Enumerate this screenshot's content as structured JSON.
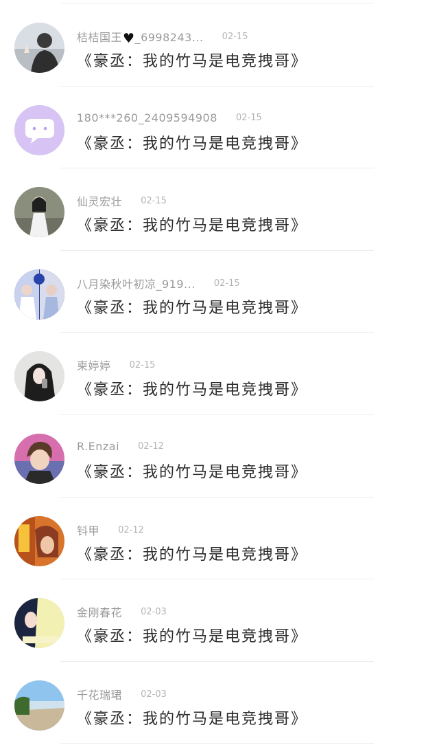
{
  "comments": [
    {
      "username": "桔桔国王",
      "username_suffix": "_6998243...",
      "has_heart": true,
      "date": "02-15",
      "text": "《豪丞：我的竹马是电竞拽哥》",
      "avatar": "avatar-woman-grey"
    },
    {
      "username": "180***260_2409594908",
      "username_suffix": "",
      "has_heart": false,
      "date": "02-15",
      "text": "《豪丞：我的竹马是电竞拽哥》",
      "avatar": "avatar-default-purple-chat-icon"
    },
    {
      "username": "仙灵宏壮",
      "username_suffix": "",
      "has_heart": false,
      "date": "02-15",
      "text": "《豪丞：我的竹马是电竞拽哥》",
      "avatar": "avatar-girl-outdoor"
    },
    {
      "username": "八月染秋叶初凉_919...",
      "username_suffix": "",
      "has_heart": false,
      "date": "02-15",
      "text": "《豪丞：我的竹马是电竞拽哥》",
      "avatar": "avatar-couple-blue"
    },
    {
      "username": "柬婷婷",
      "username_suffix": "",
      "has_heart": false,
      "date": "02-15",
      "text": "《豪丞：我的竹马是电竞拽哥》",
      "avatar": "avatar-girl-long-hair"
    },
    {
      "username": "R.Enzai",
      "username_suffix": "",
      "has_heart": false,
      "date": "02-12",
      "text": "《豪丞：我的竹马是电竞拽哥》",
      "avatar": "avatar-boy-pink"
    },
    {
      "username": "钭甲",
      "username_suffix": "",
      "has_heart": false,
      "date": "02-12",
      "text": "《豪丞：我的竹马是电竞拽哥》",
      "avatar": "avatar-anime-orange"
    },
    {
      "username": "金刚春花",
      "username_suffix": "",
      "has_heart": false,
      "date": "02-03",
      "text": "《豪丞：我的竹马是电竞拽哥》",
      "avatar": "avatar-anime-yellow"
    },
    {
      "username": "千花瑞珺",
      "username_suffix": "",
      "has_heart": false,
      "date": "02-03",
      "text": "《豪丞：我的竹马是电竞拽哥》",
      "avatar": "avatar-sky-landscape"
    }
  ],
  "colors": {
    "username": "#9a9a9a",
    "date": "#b4b4b4",
    "text": "#2a2a2a",
    "divider": "#eeeeee",
    "background": "#ffffff"
  }
}
